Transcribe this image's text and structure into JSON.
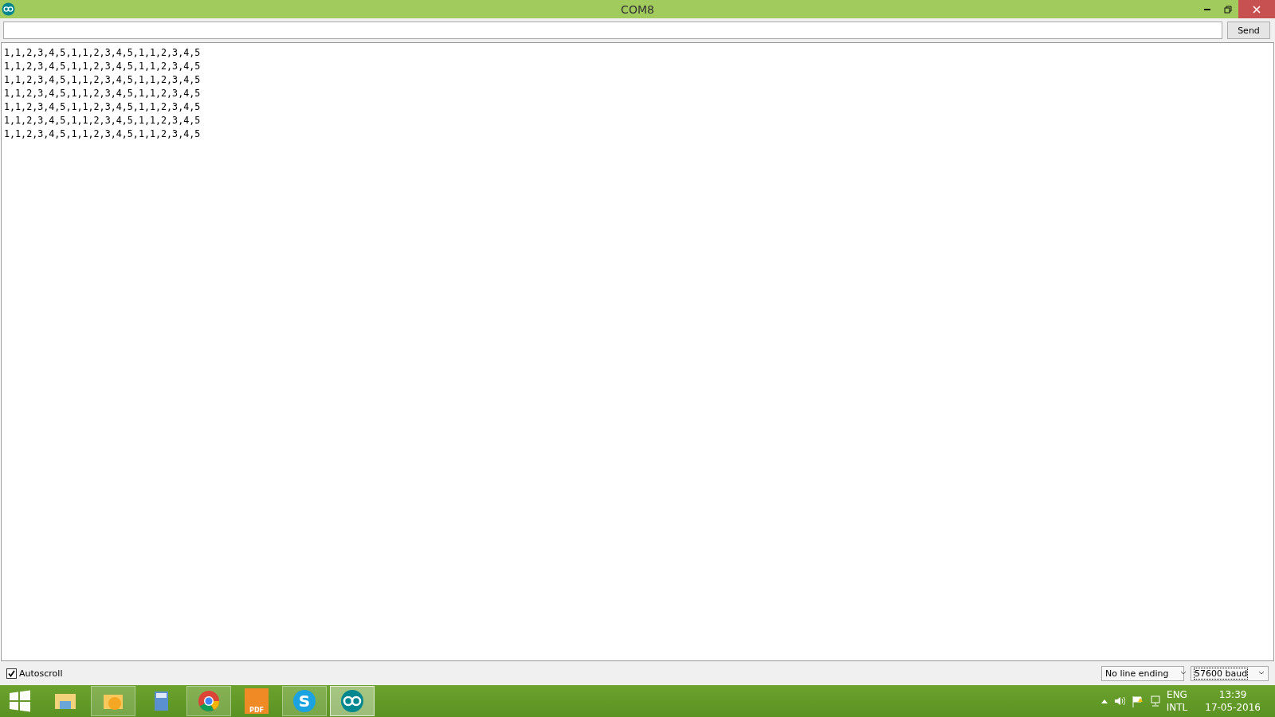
{
  "window": {
    "title": "COM8"
  },
  "send_button": {
    "label": "Send"
  },
  "output_lines": [
    "1,1,2,3,4,5,1,1,2,3,4,5,1,1,2,3,4,5",
    "1,1,2,3,4,5,1,1,2,3,4,5,1,1,2,3,4,5",
    "1,1,2,3,4,5,1,1,2,3,4,5,1,1,2,3,4,5",
    "1,1,2,3,4,5,1,1,2,3,4,5,1,1,2,3,4,5",
    "1,1,2,3,4,5,1,1,2,3,4,5,1,1,2,3,4,5",
    "1,1,2,3,4,5,1,1,2,3,4,5,1,1,2,3,4,5",
    "1,1,2,3,4,5,1,1,2,3,4,5,1,1,2,3,4,5"
  ],
  "autoscroll": {
    "label": "Autoscroll",
    "checked": true
  },
  "line_ending": {
    "value": "No line ending"
  },
  "baud_rate": {
    "value": "57600 baud"
  },
  "taskbar": {
    "apps": [
      {
        "kind": "folder",
        "running": false,
        "selected": false
      },
      {
        "kind": "mail",
        "running": true,
        "selected": false
      },
      {
        "kind": "calculator",
        "running": false,
        "selected": false
      },
      {
        "kind": "browser",
        "running": true,
        "selected": false
      },
      {
        "kind": "pdf",
        "glyph": "PDF",
        "running": false,
        "selected": false
      },
      {
        "kind": "chat",
        "glyph": "S",
        "running": true,
        "selected": false
      },
      {
        "kind": "infinity",
        "running": true,
        "selected": true
      }
    ],
    "language": "ENG",
    "layout": "INTL",
    "time": "13:39",
    "date": "17-05-2016"
  }
}
